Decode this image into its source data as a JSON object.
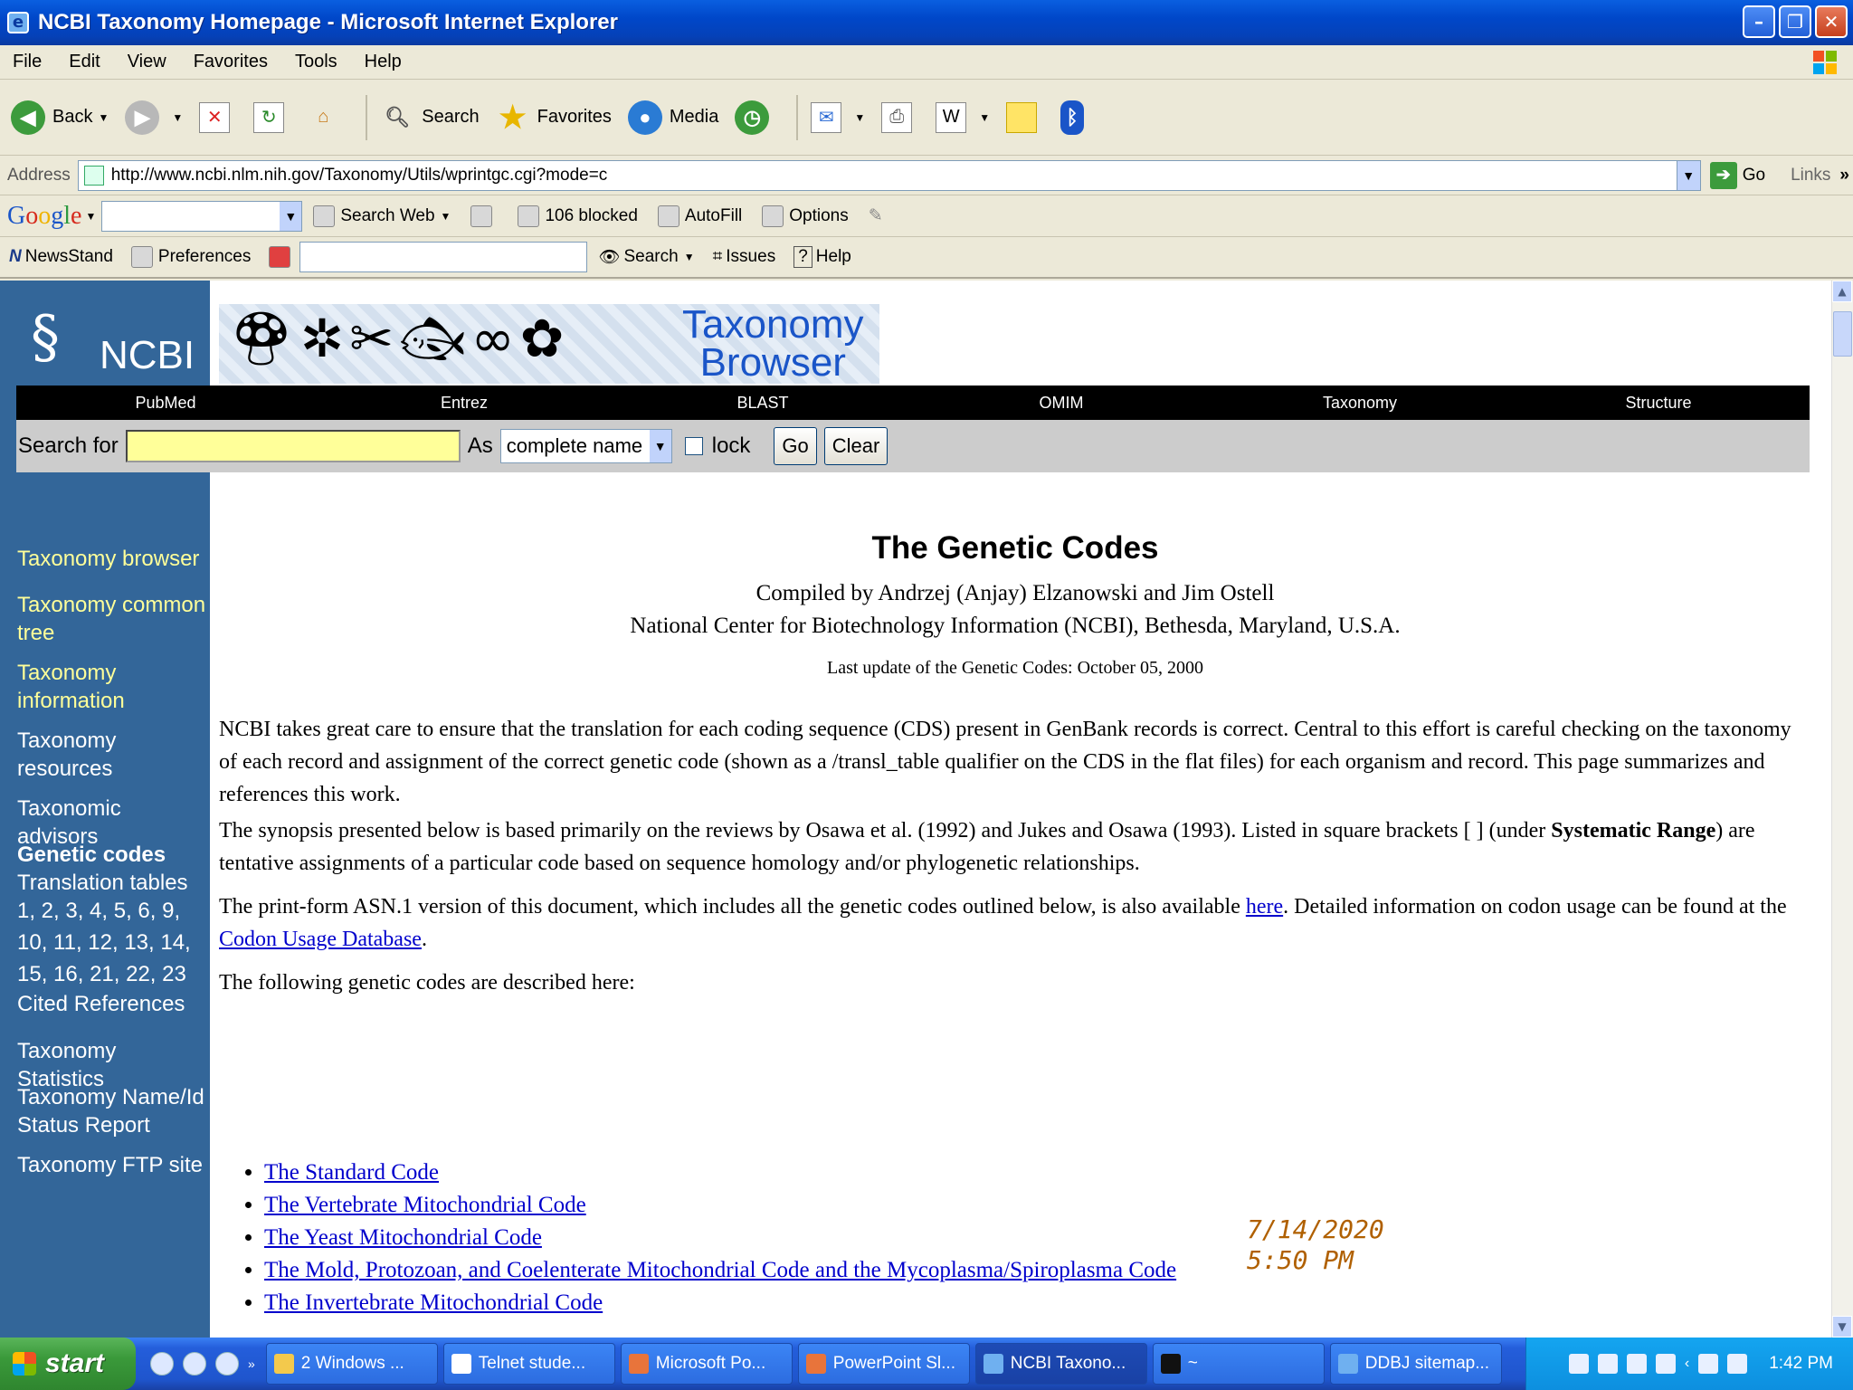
{
  "window": {
    "title": "NCBI Taxonomy Homepage - Microsoft Internet Explorer"
  },
  "menubar": {
    "items": [
      "File",
      "Edit",
      "View",
      "Favorites",
      "Tools",
      "Help"
    ]
  },
  "toolbar": {
    "back_label": "Back",
    "search_label": "Search",
    "favorites_label": "Favorites",
    "media_label": "Media",
    "word_label": "W"
  },
  "addressbar": {
    "label": "Address",
    "url": "http://www.ncbi.nlm.nih.gov/Taxonomy/Utils/wprintgc.cgi?mode=c",
    "go_label": "Go",
    "links_label": "Links"
  },
  "googlebar": {
    "logo": [
      "G",
      "o",
      "o",
      "g",
      "l",
      "e"
    ],
    "search_web_label": "Search Web",
    "blocked_label": "106 blocked",
    "autofill_label": "AutoFill",
    "options_label": "Options"
  },
  "newsbar": {
    "newsstand_label": "NewsStand",
    "preferences_label": "Preferences",
    "search_label": "Search",
    "issues_label": "Issues",
    "help_label": "Help"
  },
  "page": {
    "ncbi_logo_text": "NCBI",
    "banner_title_line1": "Taxonomy",
    "banner_title_line2": "Browser",
    "nav": [
      "PubMed",
      "Entrez",
      "BLAST",
      "OMIM",
      "Taxonomy",
      "Structure"
    ],
    "search": {
      "search_for_label": "Search for",
      "as_label": "As",
      "as_value": "complete name",
      "lock_label": "lock",
      "go_label": "Go",
      "clear_label": "Clear"
    },
    "sidebar": {
      "taxonomy_browser": "Taxonomy browser",
      "common_tree": "Taxonomy common tree",
      "information": "Taxonomy information",
      "resources": "Taxonomy resources",
      "advisors": "Taxonomic advisors",
      "genetic_codes": "Genetic codes",
      "translation_tables": "Translation tables",
      "tables_line1": "1, 2, 3, 4, 5, 6, 9,",
      "tables_line2": "10, 11, 12, 13, 14,",
      "tables_line3": "15, 16, 21, 22, 23",
      "cited_references": "Cited References",
      "statistics": "Taxonomy Statistics",
      "name_id_status": "Taxonomy Name/Id Status Report",
      "ftp_site": "Taxonomy FTP site"
    },
    "heading": "The Genetic Codes",
    "credits_line1": "Compiled by Andrzej (Anjay) Elzanowski and Jim Ostell",
    "credits_line2": "National Center for Biotechnology Information (NCBI), Bethesda, Maryland, U.S.A.",
    "last_update": "Last update of the Genetic Codes: October 05, 2000",
    "para1": "NCBI takes great care to ensure that the translation for each coding sequence (CDS) present in GenBank records is correct. Central to this effort is careful checking on the taxonomy of each record and assignment of the correct genetic code (shown as a /transl_table qualifier on the CDS in the flat files) for each organism and record. This page summarizes and references this work.",
    "para2_a": "The synopsis presented below is based primarily on the reviews by Osawa et al. (1992) and Jukes and Osawa (1993). Listed in square brackets [ ] (under ",
    "para2_bold": "Systematic Range",
    "para2_b": ") are tentative assignments of a particular code based on sequence homology and/or phylogenetic relationships.",
    "para3_a": "The print-form ASN.1 version of this document, which includes all the genetic codes outlined below, is also available ",
    "para3_link1": "here",
    "para3_b": ". Detailed information on codon usage can be found at the ",
    "para3_link2": "Codon Usage Database",
    "para3_c": ".",
    "para4": "The following genetic codes are described here:",
    "codes": [
      "The Standard Code",
      "The Vertebrate Mitochondrial Code",
      "The Yeast Mitochondrial Code",
      "The Mold, Protozoan, and Coelenterate Mitochondrial Code and the Mycoplasma/Spiroplasma Code",
      "The Invertebrate Mitochondrial Code"
    ],
    "timestamp_date": "7/14/2020",
    "timestamp_time": "5:50 PM"
  },
  "taskbar": {
    "start_label": "start",
    "tasks": [
      "2 Windows ...",
      "Telnet stude...",
      "Microsoft Po...",
      "PowerPoint Sl...",
      "NCBI Taxono...",
      "~",
      "DDBJ sitemap..."
    ],
    "clock": "1:42 PM"
  },
  "colors": {
    "sidebar_bg": "#336699",
    "sidebar_link": "#ffff99",
    "nav_bg": "#000000",
    "search_input_bg": "#ffff99",
    "link": "#0000cc",
    "timestamp": "#b06000"
  }
}
